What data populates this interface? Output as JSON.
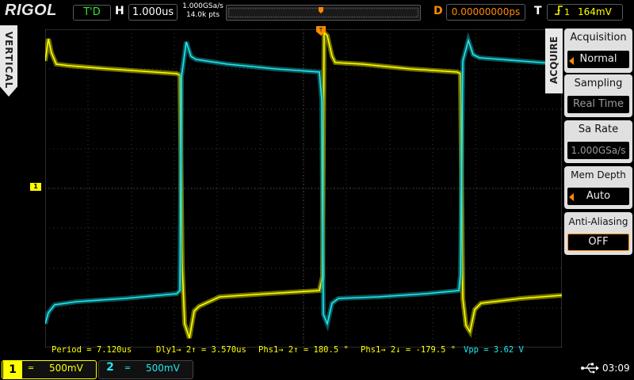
{
  "brand": {
    "logo": "RIGOL"
  },
  "top": {
    "status": "T'D",
    "horizontal_label": "H",
    "horizontal_scale": "1.000us",
    "sample_rate": "1.000GSa/s",
    "memory_points": "14.0k pts",
    "delay_label": "D",
    "delay_value": "0.00000000ps",
    "trigger_label": "T",
    "trigger_channel": "1",
    "trigger_level": "164mV"
  },
  "left_tab": {
    "label": "VERTICAL"
  },
  "channel_marker": "1",
  "measurements": {
    "period": "Period = 7.120us",
    "delay": "Dly1→ 2↑ = 3.570us",
    "phase_rise": "Phs1→ 2↑ = 180.5 °",
    "phase_fall": "Phs1→ 2↓ = -179.5 °",
    "vpp": "Vpp = 3.62 V"
  },
  "menu": {
    "tab": "ACQUIRE",
    "items": [
      {
        "title": "Acquisition",
        "value": "Normal"
      },
      {
        "title": "Sampling",
        "value": "Real Time"
      },
      {
        "title": "Sa Rate",
        "value": "1.000GSa/s"
      },
      {
        "title": "Mem Depth",
        "value": "Auto"
      },
      {
        "title": "Anti-Aliasing",
        "value": "OFF"
      }
    ]
  },
  "bottom": {
    "ch1": {
      "number": "1",
      "coupling": "═",
      "scale": "500mV"
    },
    "ch2": {
      "number": "2",
      "coupling": "═",
      "scale": "500mV"
    },
    "time": "03:09"
  },
  "colors": {
    "ch1": "#ffff00",
    "ch2": "#20e8f0",
    "accent": "#ff8a00",
    "status": "#32e632"
  },
  "icons": {
    "usb": "usb-icon",
    "trigger_edge": "rising-edge-icon"
  }
}
